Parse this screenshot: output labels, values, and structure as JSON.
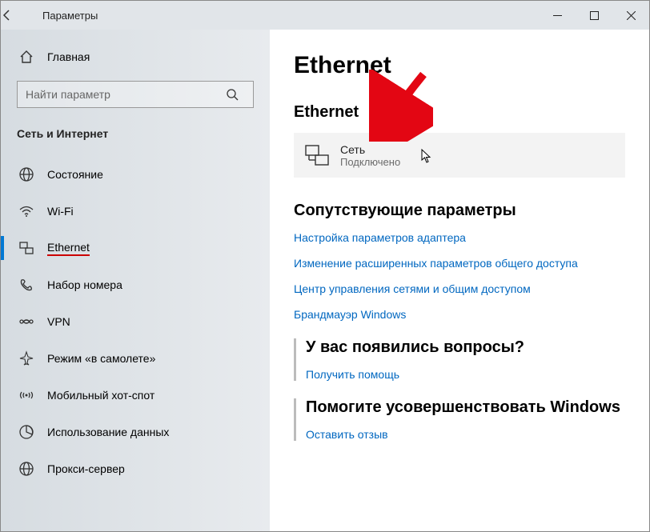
{
  "titlebar": {
    "title": "Параметры"
  },
  "sidebar": {
    "home": "Главная",
    "search_placeholder": "Найти параметр",
    "group": "Сеть и Интернет",
    "items": [
      {
        "label": "Состояние"
      },
      {
        "label": "Wi-Fi"
      },
      {
        "label": "Ethernet"
      },
      {
        "label": "Набор номера"
      },
      {
        "label": "VPN"
      },
      {
        "label": "Режим «в самолете»"
      },
      {
        "label": "Мобильный хот-спот"
      },
      {
        "label": "Использование данных"
      },
      {
        "label": "Прокси-сервер"
      }
    ]
  },
  "main": {
    "page_title": "Ethernet",
    "section_title": "Ethernet",
    "connection": {
      "name": "Сеть",
      "status": "Подключено"
    },
    "related_heading": "Сопутствующие параметры",
    "links": [
      "Настройка параметров адаптера",
      "Изменение расширенных параметров общего доступа",
      "Центр управления сетями и общим доступом",
      "Брандмауэр Windows"
    ],
    "help_heading": "У вас появились вопросы?",
    "help_link": "Получить помощь",
    "feedback_heading": "Помогите усовершенствовать Windows",
    "feedback_link": "Оставить отзыв"
  }
}
